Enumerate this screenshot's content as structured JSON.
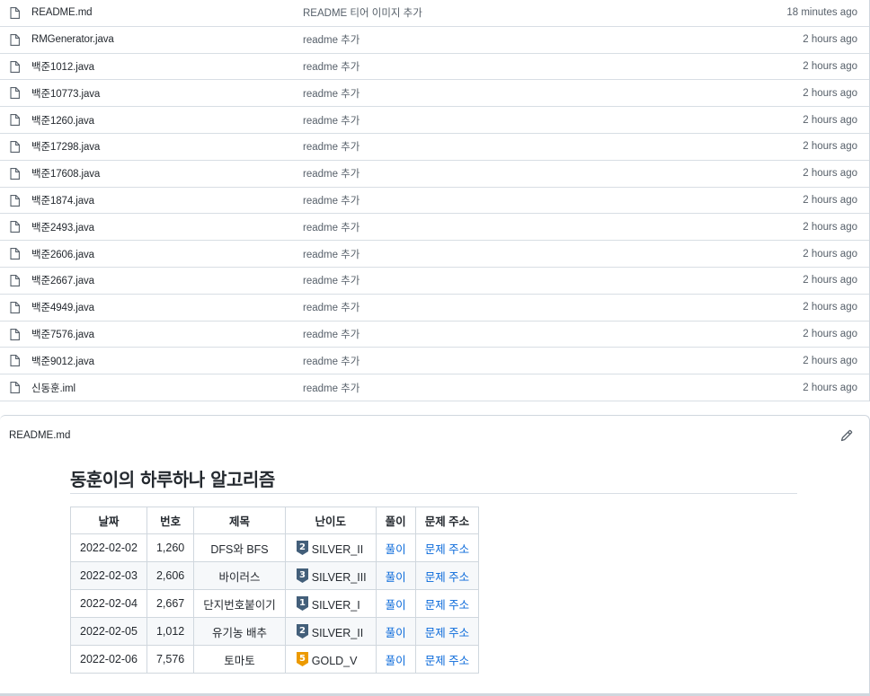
{
  "files": [
    {
      "name": "README.md",
      "message": "README 티어 이미지 추가",
      "time": "18 minutes ago"
    },
    {
      "name": "RMGenerator.java",
      "message": "readme 추가",
      "time": "2 hours ago"
    },
    {
      "name": "백준1012.java",
      "message": "readme 추가",
      "time": "2 hours ago"
    },
    {
      "name": "백준10773.java",
      "message": "readme 추가",
      "time": "2 hours ago"
    },
    {
      "name": "백준1260.java",
      "message": "readme 추가",
      "time": "2 hours ago"
    },
    {
      "name": "백준17298.java",
      "message": "readme 추가",
      "time": "2 hours ago"
    },
    {
      "name": "백준17608.java",
      "message": "readme 추가",
      "time": "2 hours ago"
    },
    {
      "name": "백준1874.java",
      "message": "readme 추가",
      "time": "2 hours ago"
    },
    {
      "name": "백준2493.java",
      "message": "readme 추가",
      "time": "2 hours ago"
    },
    {
      "name": "백준2606.java",
      "message": "readme 추가",
      "time": "2 hours ago"
    },
    {
      "name": "백준2667.java",
      "message": "readme 추가",
      "time": "2 hours ago"
    },
    {
      "name": "백준4949.java",
      "message": "readme 추가",
      "time": "2 hours ago"
    },
    {
      "name": "백준7576.java",
      "message": "readme 추가",
      "time": "2 hours ago"
    },
    {
      "name": "백준9012.java",
      "message": "readme 추가",
      "time": "2 hours ago"
    },
    {
      "name": "신동훈.iml",
      "message": "readme 추가",
      "time": "2 hours ago"
    }
  ],
  "readme": {
    "label": "README.md",
    "title": "동훈이의 하루하나 알고리즘",
    "table": {
      "headers": [
        "날짜",
        "번호",
        "제목",
        "난이도",
        "풀이",
        "문제 주소"
      ],
      "rows": [
        {
          "date": "2022-02-02",
          "number": "1,260",
          "title": "DFS와 BFS",
          "tier_num": "2",
          "tier_color": "#435f7a",
          "tier": "SILVER_II",
          "solution": "풀이",
          "link": "문제 주소"
        },
        {
          "date": "2022-02-03",
          "number": "2,606",
          "title": "바이러스",
          "tier_num": "3",
          "tier_color": "#435f7a",
          "tier": "SILVER_III",
          "solution": "풀이",
          "link": "문제 주소"
        },
        {
          "date": "2022-02-04",
          "number": "2,667",
          "title": "단지번호붙이기",
          "tier_num": "1",
          "tier_color": "#435f7a",
          "tier": "SILVER_I",
          "solution": "풀이",
          "link": "문제 주소"
        },
        {
          "date": "2022-02-05",
          "number": "1,012",
          "title": "유기농 배추",
          "tier_num": "2",
          "tier_color": "#435f7a",
          "tier": "SILVER_II",
          "solution": "풀이",
          "link": "문제 주소"
        },
        {
          "date": "2022-02-06",
          "number": "7,576",
          "title": "토마토",
          "tier_num": "5",
          "tier_color": "#ec9a00",
          "tier": "GOLD_V",
          "solution": "풀이",
          "link": "문제 주소"
        }
      ]
    }
  },
  "colors": {
    "link": "#0969da",
    "muted": "#57606a",
    "border": "#d0d7de"
  },
  "icons": {
    "file": "file-icon",
    "edit": "pencil-icon",
    "tier": "tier-badge-icon"
  }
}
